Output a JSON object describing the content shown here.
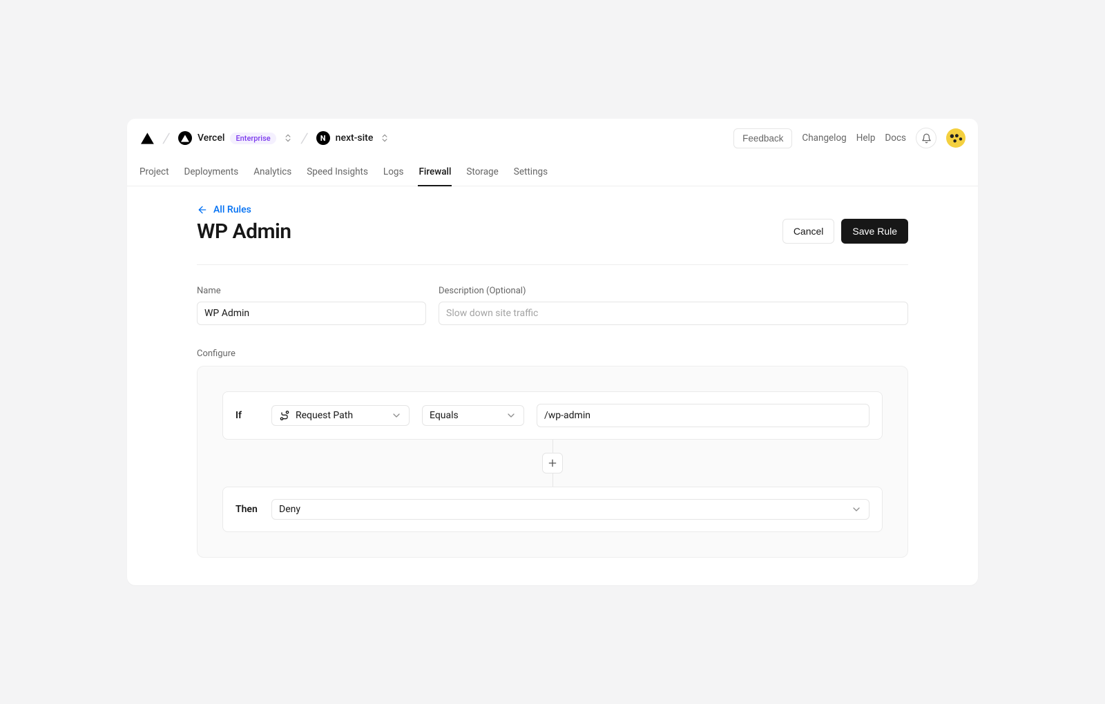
{
  "header": {
    "org": "Vercel",
    "badge": "Enterprise",
    "project": "next-site",
    "feedback": "Feedback",
    "links": [
      "Changelog",
      "Help",
      "Docs"
    ]
  },
  "tabs": [
    "Project",
    "Deployments",
    "Analytics",
    "Speed Insights",
    "Logs",
    "Firewall",
    "Storage",
    "Settings"
  ],
  "active_tab": "Firewall",
  "page": {
    "back_link": "All Rules",
    "title": "WP Admin",
    "cancel": "Cancel",
    "save": "Save Rule"
  },
  "form": {
    "name_label": "Name",
    "name_value": "WP Admin",
    "desc_label": "Description (Optional)",
    "desc_placeholder": "Slow down site traffic",
    "configure_label": "Configure"
  },
  "rule": {
    "if_kw": "If",
    "field": "Request Path",
    "operator": "Equals",
    "value": "/wp-admin",
    "then_kw": "Then",
    "action": "Deny"
  }
}
